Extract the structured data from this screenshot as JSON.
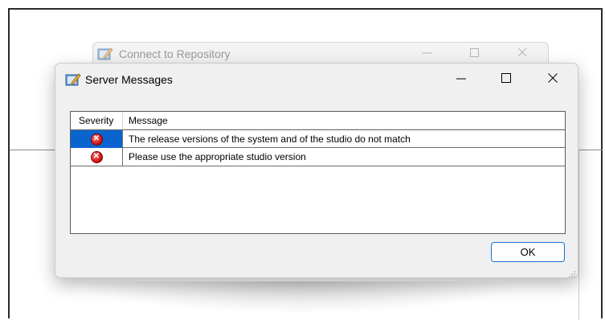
{
  "background_window": {
    "title": "Connect to Repository",
    "icon": "app-icon",
    "controls": {
      "minimize": "minimize-icon",
      "maximize": "maximize-icon",
      "close": "close-icon"
    }
  },
  "dialog": {
    "title": "Server Messages",
    "icon": "app-icon",
    "controls": {
      "minimize": "minimize-icon",
      "maximize": "maximize-icon",
      "close": "close-icon"
    },
    "list": {
      "headers": [
        "Severity",
        "Message"
      ],
      "rows": [
        {
          "severity_icon": "error-icon",
          "message": "The release versions of the system and of the studio do not match",
          "selected": true
        },
        {
          "severity_icon": "error-icon",
          "message": "Please use the appropriate studio version",
          "selected": false
        }
      ]
    },
    "ok_label": "OK"
  },
  "colors": {
    "selection": "#0a64d0",
    "error": "#d41616",
    "button_border": "#1a6fc9"
  }
}
